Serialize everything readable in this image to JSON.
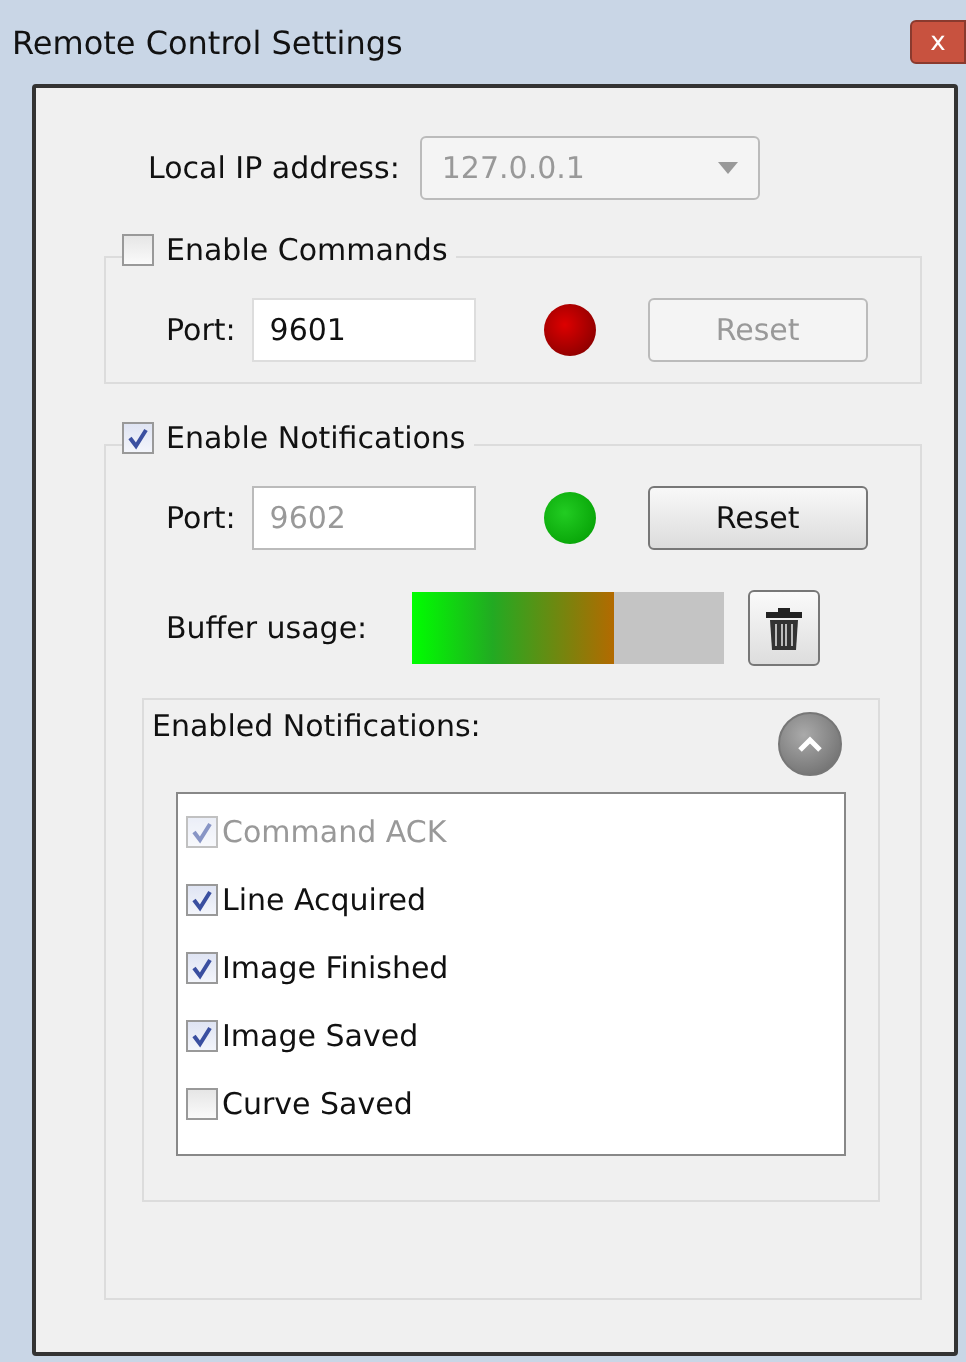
{
  "window": {
    "title": "Remote Control Settings",
    "close": "x"
  },
  "local_ip": {
    "label": "Local IP address:",
    "value": "127.0.0.1",
    "disabled": true
  },
  "commands": {
    "label": "Enable Commands",
    "checked": false,
    "port_label": "Port:",
    "port": "9601",
    "port_disabled": false,
    "connected": false,
    "reset": "Reset",
    "reset_disabled": true
  },
  "notifications": {
    "label": "Enable Notifications",
    "checked": true,
    "port_label": "Port:",
    "port": "9602",
    "port_disabled": true,
    "connected": true,
    "reset": "Reset",
    "reset_disabled": false,
    "buffer_label": "Buffer usage:",
    "buffer": {
      "level": 0.65
    },
    "enabled_label": "Enabled Notifications:",
    "expanded": true,
    "items": [
      {
        "label": "Command ACK",
        "checked": true,
        "disabled": true
      },
      {
        "label": "Line Acquired",
        "checked": true,
        "disabled": false
      },
      {
        "label": "Image Finished",
        "checked": true,
        "disabled": false
      },
      {
        "label": "Image Saved",
        "checked": true,
        "disabled": false
      },
      {
        "label": "Curve Saved",
        "checked": false,
        "disabled": false
      }
    ]
  }
}
